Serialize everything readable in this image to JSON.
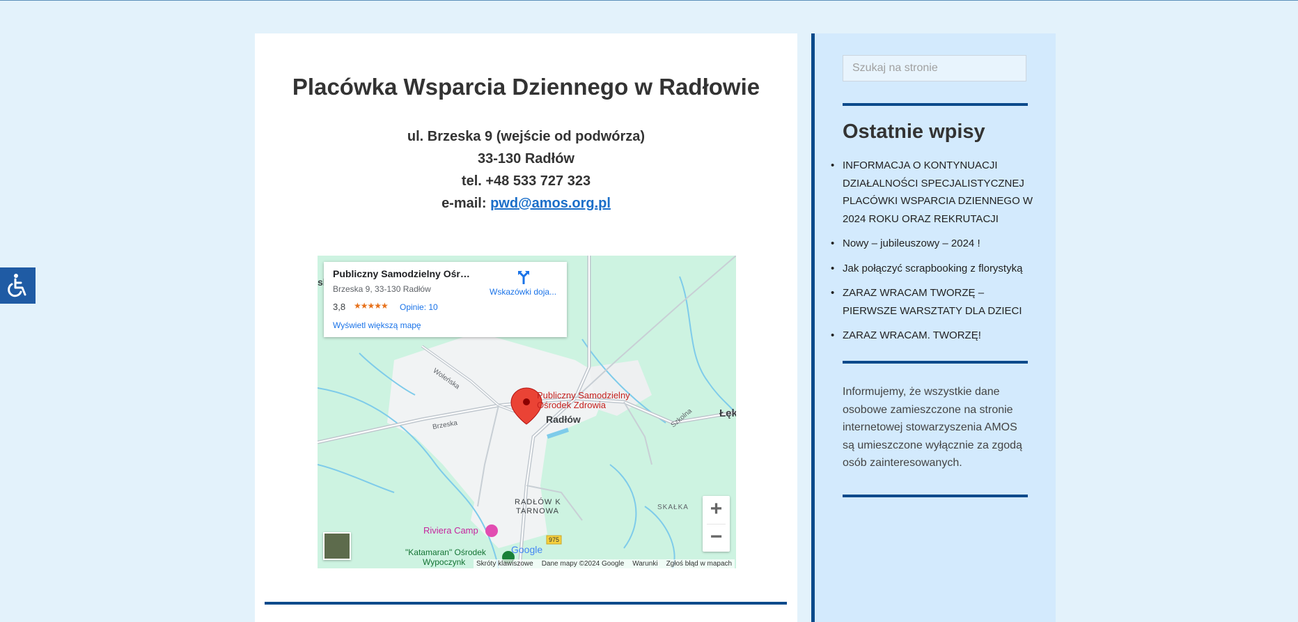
{
  "page": {
    "title": "Placówka Wsparcia Dziennego w Radłowie",
    "address_line1": "ul. Brzeska 9 (wejście od podwórza)",
    "address_line2": "33-130 Radłów",
    "phone": "tel. +48 533 727 323",
    "email_label": "e-mail: ",
    "email": "pwd@amos.org.pl"
  },
  "map": {
    "place_name": "Publiczny Samodzielny Ośrod...",
    "place_address": "Brzeska 9, 33-130 Radłów",
    "rating": "3,8",
    "stars": "★★★★★",
    "reviews": "Opinie: 10",
    "directions": "Wskazówki doja...",
    "larger_map": "Wyświetl większą mapę",
    "marker_label_1": "Publiczny Samodzielny",
    "marker_label_2": "Ośrodek Zdrowia",
    "town": "Radłów",
    "district_1": "RADŁÓW K",
    "district_2": "TARNOWA",
    "skalka": "SKAŁKA",
    "riviera": "Riviera Camp",
    "katamaran_1": "\"Katamaran\" Ośrodek",
    "katamaran_2": "Wypoczynk",
    "road_975": "975",
    "road_wolenska": "Woleńska",
    "road_brzeska": "Brzeska",
    "road_szkolna": "Szkolna",
    "edge_left": "sk",
    "edge_right": "Łęk",
    "google": "Google",
    "zoom_in": "+",
    "zoom_out": "−",
    "attribution": [
      "Skróty klawiszowe",
      "Dane mapy ©2024 Google",
      "Warunki",
      "Zgłoś błąd w mapach"
    ]
  },
  "sidebar": {
    "search_placeholder": "Szukaj na stronie",
    "recent_title": "Ostatnie wpisy",
    "posts": [
      "INFORMACJA O KONTYNUACJI DZIAŁALNOŚCI SPECJALISTYCZNEJ PLACÓWKI WSPARCIA DZIENNEGO W 2024  ROKU ORAZ REKRUTACJI",
      "Nowy – jubileuszowy – 2024 !",
      "Jak połączyć scrapbooking z florystyką",
      "ZARAZ WRACAM TWORZĘ – PIERWSZE WARSZTATY DLA DZIECI",
      "ZARAZ WRACAM. TWORZĘ!"
    ],
    "notice": "Informujemy, że wszystkie dane osobowe zamieszczone na stronie internetowej stowarzyszenia AMOS są umieszczone wyłącznie za zgodą osób zainteresowanych."
  },
  "colors": {
    "background": "#e3f2fb",
    "sidebar_bg": "#d3eafd",
    "accent": "#0b4a8b",
    "link": "#1a6ec9",
    "a11y_button": "#1f5ba4"
  },
  "icons": {
    "accessibility": "wheelchair-icon",
    "directions": "directions-icon",
    "marker": "map-pin-icon"
  }
}
